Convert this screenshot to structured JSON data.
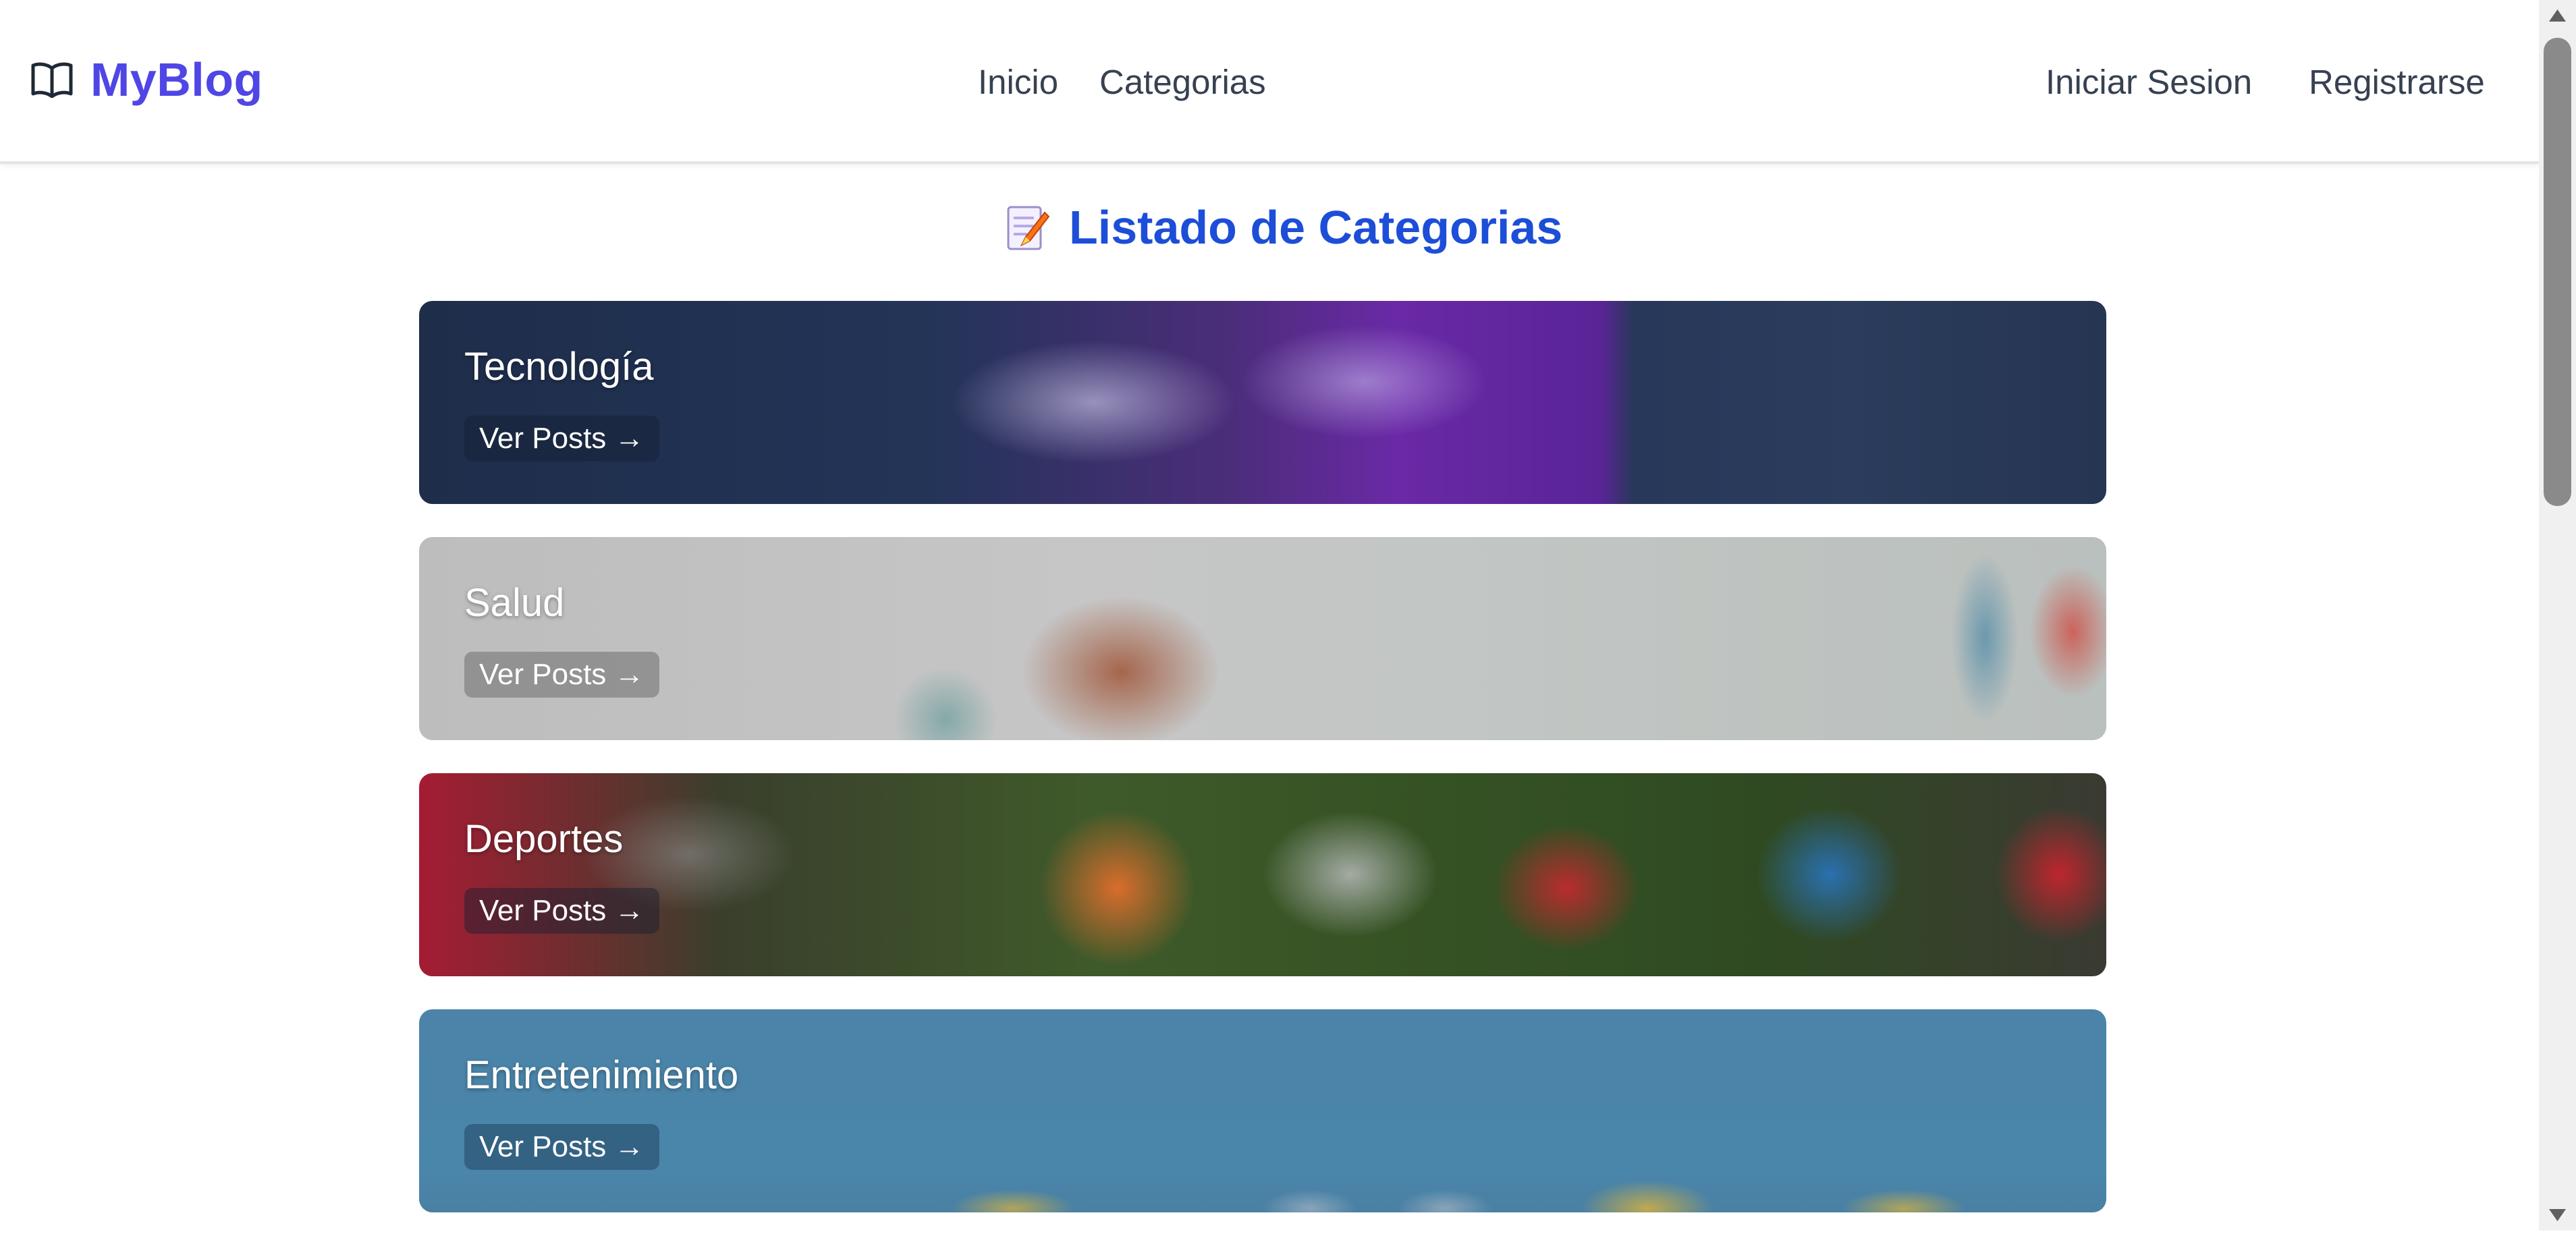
{
  "navbar": {
    "brand": "MyBlog",
    "brand_icon": "open-book-icon",
    "links": [
      "Inicio",
      "Categorias"
    ],
    "auth": [
      "Iniciar Sesion",
      "Registrarse"
    ]
  },
  "page": {
    "title": "Listado de Categorias",
    "title_icon": "memo-icon"
  },
  "categories": [
    {
      "name": "Tecnología",
      "button": "Ver Posts →"
    },
    {
      "name": "Salud",
      "button": "Ver Posts →"
    },
    {
      "name": "Deportes",
      "button": "Ver Posts →"
    },
    {
      "name": "Entretenimiento",
      "button": "Ver Posts →"
    }
  ],
  "colors": {
    "brand": "#4f46e5",
    "title": "#1d4ed8",
    "nav_text": "#374151"
  }
}
